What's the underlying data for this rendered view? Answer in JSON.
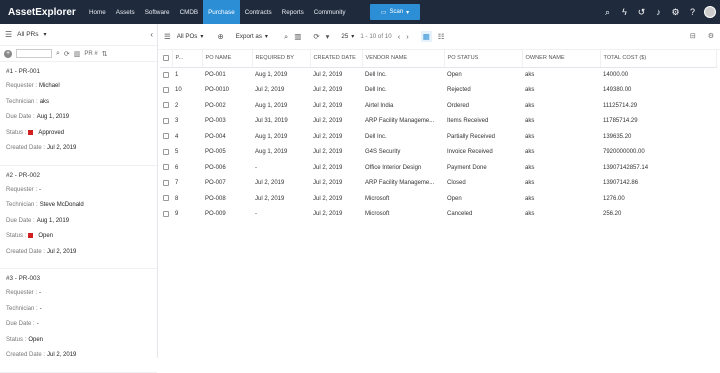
{
  "app": {
    "logo": "AssetExplorer"
  },
  "nav": {
    "items": [
      "Home",
      "Assets",
      "Software",
      "CMDB",
      "Purchase",
      "Contracts",
      "Reports",
      "Community"
    ],
    "active": "Purchase"
  },
  "scan": {
    "label": "Scan",
    "caret": "▾"
  },
  "left": {
    "filter": "All PRs",
    "sort_label": "PR #",
    "cards": [
      {
        "id": "#1 - PR-001",
        "requester": "Michael",
        "technician": "aks",
        "due": "Aug 1, 2019",
        "status": "Approved",
        "created": "Jul 2, 2019",
        "flag": true
      },
      {
        "id": "#2 - PR-002",
        "requester": "-",
        "technician": "Steve McDonald",
        "due": "Aug 1, 2019",
        "status": "Open",
        "created": "Jul 2, 2019",
        "flag": true
      },
      {
        "id": "#3 - PR-003",
        "requester": "-",
        "technician": "-",
        "due": "-",
        "status": "Open",
        "created": "Jul 2, 2019",
        "flag": false
      }
    ],
    "labels": {
      "requester": "Requester :",
      "technician": "Technician :",
      "due": "Due Date :",
      "status": "Status :",
      "created": "Created Date :"
    }
  },
  "toolbar": {
    "filter": "All POs",
    "export": "Export as",
    "per_page": "25",
    "range": "1 - 10 of 10"
  },
  "table": {
    "columns": [
      "P...",
      "PO NAME",
      "REQUIRED BY",
      "CREATED DATE",
      "VENDOR NAME",
      "PO STATUS",
      "OWNER NAME",
      "TOTAL COST ($)"
    ],
    "rows": [
      [
        "1",
        "PO-001",
        "Aug 1, 2019",
        "Jul 2, 2019",
        "Dell Inc.",
        "Open",
        "aks",
        "14000.00"
      ],
      [
        "10",
        "PO-0010",
        "Jul 2, 2019",
        "Jul 2, 2019",
        "Dell Inc.",
        "Rejected",
        "aks",
        "149380.00"
      ],
      [
        "2",
        "PO-002",
        "Aug 1, 2019",
        "Jul 2, 2019",
        "Airtel India",
        "Ordered",
        "aks",
        "11125714.29"
      ],
      [
        "3",
        "PO-003",
        "Jul 31, 2019",
        "Jul 2, 2019",
        "ARP Facility Manageme...",
        "Items Received",
        "aks",
        "11785714.29"
      ],
      [
        "4",
        "PO-004",
        "Aug 1, 2019",
        "Jul 2, 2019",
        "Dell Inc.",
        "Partially Received",
        "aks",
        "139635.20"
      ],
      [
        "5",
        "PO-005",
        "Aug 1, 2019",
        "Jul 2, 2019",
        "G4S Security",
        "Invoice Received",
        "aks",
        "7920000000.00"
      ],
      [
        "6",
        "PO-006",
        "-",
        "Jul 2, 2019",
        "Office Interior Design",
        "Payment Done",
        "aks",
        "13907142857.14"
      ],
      [
        "7",
        "PO-007",
        "Jul 2, 2019",
        "Jul 2, 2019",
        "ARP Facility Manageme...",
        "Closed",
        "aks",
        "13907142.86"
      ],
      [
        "8",
        "PO-008",
        "Jul 2, 2019",
        "Jul 2, 2019",
        "Microsoft",
        "Open",
        "aks",
        "1276.00"
      ],
      [
        "9",
        "PO-009",
        "-",
        "Jul 2, 2019",
        "Microsoft",
        "Canceled",
        "aks",
        "256.20"
      ]
    ]
  }
}
